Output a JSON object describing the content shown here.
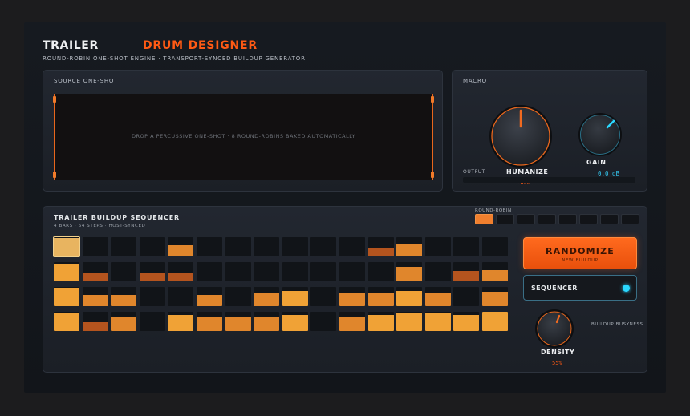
{
  "header": {
    "title_a": "TRAILER",
    "title_b": "DRUM DESIGNER",
    "subtitle": "ROUND-ROBIN ONE-SHOT ENGINE  ·  TRANSPORT-SYNCED BUILDUP GENERATOR"
  },
  "source": {
    "title": "SOURCE ONE-SHOT",
    "drop_text": "DROP A PERCUSSIVE ONE-SHOT  ·  8 ROUND-ROBINS BAKED AUTOMATICALLY"
  },
  "macro": {
    "title": "MACRO",
    "output_label": "OUTPUT",
    "humanize": {
      "label": "HUMANIZE",
      "value": "30%",
      "level": 0.3
    },
    "gain": {
      "label": "GAIN",
      "value": "0.0 dB"
    }
  },
  "sequencer": {
    "title": "TRAILER BUILDUP SEQUENCER",
    "subtitle": "4 BARS · 64 STEPS · HOST-SYNCED",
    "round_robin_label": "ROUND-ROBIN",
    "round_robin_active": 0,
    "round_robin_count": 8,
    "rows": [
      [
        0.95,
        0,
        0,
        0,
        0.6,
        0,
        0,
        0,
        0,
        0,
        0,
        0.4,
        0.65,
        0,
        0,
        0
      ],
      [
        0.9,
        0.45,
        0,
        0.45,
        0.45,
        0,
        0,
        0,
        0,
        0,
        0,
        0,
        0.75,
        0,
        0.55,
        0.6
      ],
      [
        0.95,
        0.6,
        0.6,
        0,
        0,
        0.6,
        0,
        0.65,
        0.8,
        0,
        0.7,
        0.7,
        0.8,
        0.7,
        0,
        0.75
      ],
      [
        0.95,
        0.45,
        0.75,
        0,
        0.85,
        0.75,
        0.75,
        0.75,
        0.85,
        0,
        0.75,
        0.85,
        0.9,
        0.9,
        0.85,
        1.0
      ]
    ],
    "randomize_label": "RANDOMIZE",
    "randomize_sub": "NEW BUILDUP",
    "toggle_label": "SEQUENCER",
    "density": {
      "label": "DENSITY",
      "value": "55%",
      "level": 0.55
    },
    "busyness_label": "BUILDUP BUSYNESS"
  },
  "colors": {
    "accent": "#ff5a14",
    "cyan": "#2ad8ff",
    "step_hot": "#f0a236",
    "step_mid": "#e0862c",
    "step_low": "#b4541e",
    "step_first": "#e8b460"
  }
}
